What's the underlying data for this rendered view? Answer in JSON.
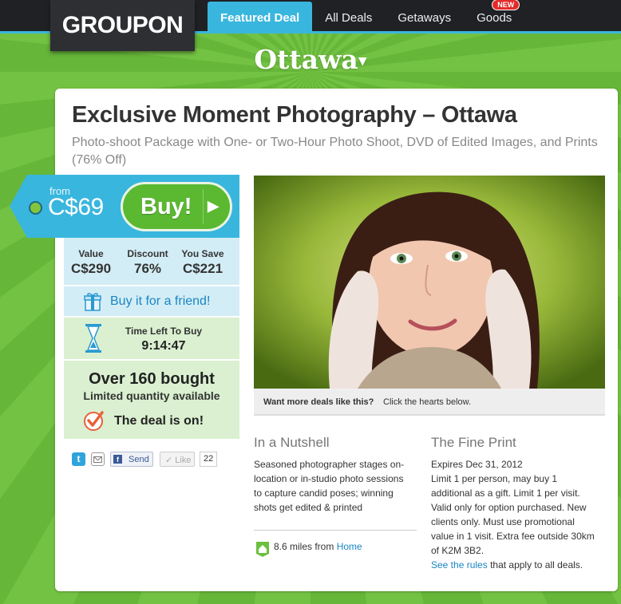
{
  "brand": {
    "logo_text": "GROUPON",
    "accent": "#39b6de",
    "green": "#6aba3c"
  },
  "nav": {
    "items": [
      {
        "label": "Featured Deal",
        "active": true
      },
      {
        "label": "All Deals"
      },
      {
        "label": "Getaways"
      },
      {
        "label": "Goods",
        "badge": "NEW"
      }
    ]
  },
  "city": {
    "name": "Ottawa",
    "icon": "chevron-down-icon"
  },
  "deal": {
    "title": "Exclusive Moment Photography – Ottawa",
    "subtitle": "Photo-shoot Package with One- or Two-Hour Photo Shoot, DVD of Edited Images, and Prints (76% Off)",
    "from_label": "from",
    "price": "C$69",
    "buy_label": "Buy!",
    "stats": [
      {
        "label": "Value",
        "value": "C$290"
      },
      {
        "label": "Discount",
        "value": "76%"
      },
      {
        "label": "You Save",
        "value": "C$221"
      }
    ],
    "gift_label": "Buy it for a friend!",
    "timer_label": "Time Left To Buy",
    "timer_value": "9:14:47",
    "bought_main": "Over 160 bought",
    "bought_sub": "Limited quantity available",
    "deal_on": "The deal is on!"
  },
  "share": {
    "send_label": "Send",
    "like_label": "Like",
    "like_count": "22"
  },
  "image": {
    "caption_bold": "Want more deals like this?",
    "caption_rest": "Click the hearts below."
  },
  "nutshell": {
    "heading": "In a Nutshell",
    "text": "Seasoned photographer stages on-location or in-studio photo sessions to capture candid poses; winning shots get edited & printed",
    "distance": "8.6 miles from",
    "home_link": "Home"
  },
  "fine_print": {
    "heading": "The Fine Print",
    "lines": [
      "Expires Dec 31, 2012",
      "Limit 1 per person, may buy 1",
      "additional as a gift. Limit 1 per visit.",
      "Valid only for option purchased. New",
      "clients only. Must use promotional",
      "value in 1 visit. Extra fee outside 30km",
      "of K2M 3B2."
    ],
    "rules_link": "See the rules",
    "rules_rest": "that apply to all deals."
  }
}
